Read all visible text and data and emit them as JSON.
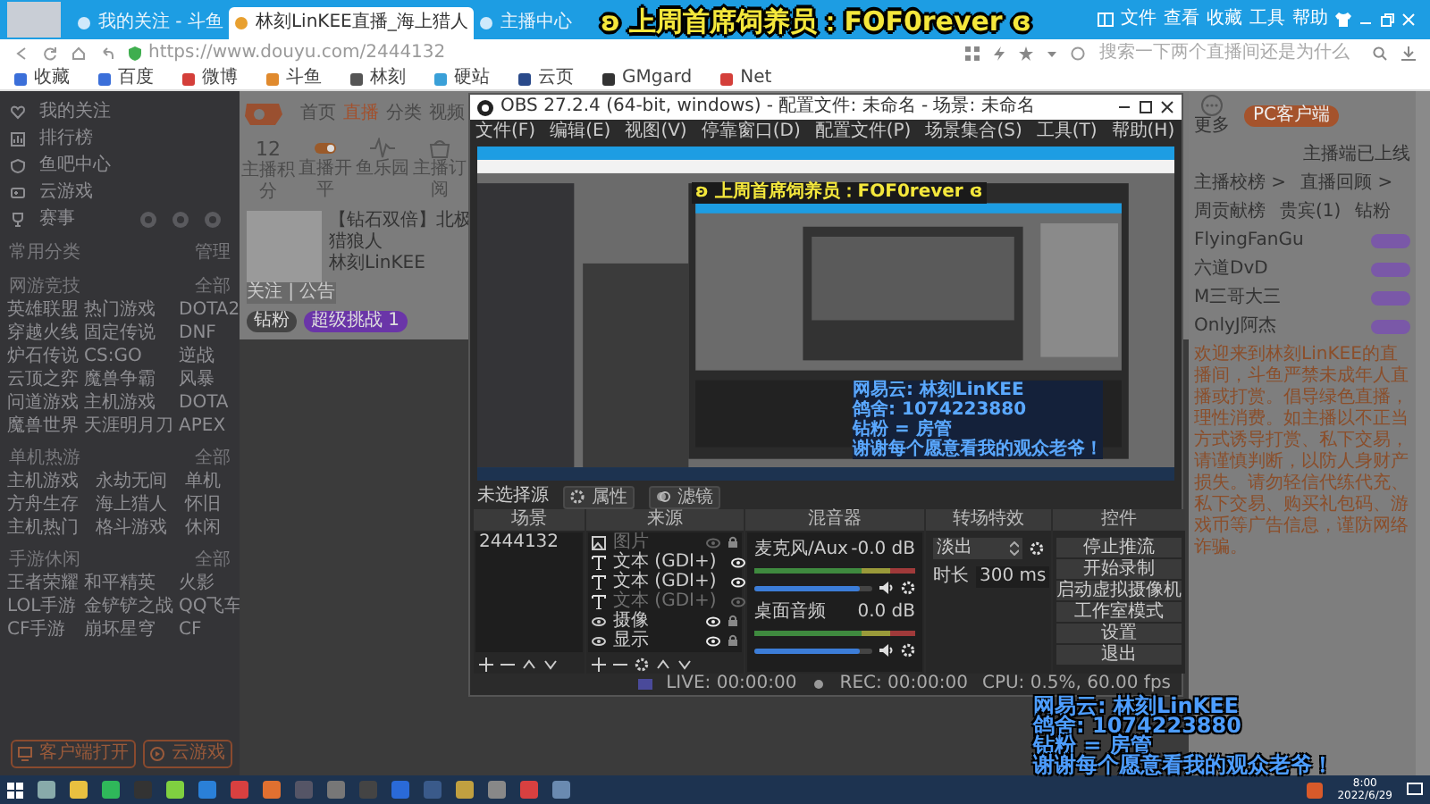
{
  "browser": {
    "tabs": [
      {
        "label": "我的关注 - 斗鱼",
        "selected": false
      },
      {
        "label": "林刻LinKEE直播_海上猎人",
        "selected": true
      },
      {
        "label": "主播中心",
        "selected": false
      }
    ],
    "menu": [
      "文件",
      "查看",
      "收藏",
      "工具",
      "帮助"
    ],
    "url": "https://www.douyu.com/2444132",
    "search": {
      "placeholder": "搜索一下两个直播间还是为什么"
    },
    "bookmarks": [
      "收藏",
      "百度",
      "微博",
      "斗鱼",
      "林刻",
      "硬站",
      "云页",
      "GMgard",
      "Net"
    ]
  },
  "overlay_title": "ʚ 上周首席饲养员：FOF0rever ɞ",
  "site": {
    "nav": [
      {
        "label": "首页",
        "selected": false
      },
      {
        "label": "直播",
        "selected": true
      },
      {
        "label": "分类",
        "selected": false
      },
      {
        "label": "视频",
        "selected": false
      }
    ],
    "sidebar": {
      "items": [
        "我的关注",
        "排行榜",
        "鱼吧中心",
        "云游戏",
        "赛事"
      ],
      "sections": [
        {
          "title": "常用分类",
          "more": "管理"
        },
        {
          "title": "网游竞技",
          "more": "全部",
          "items": [
            "英雄联盟",
            "热门游戏",
            "DOTA2",
            "穿越火线",
            "固定传说",
            "DNF",
            "炉石传说",
            "CS:GO",
            "逆战",
            "云顶之弈",
            "魔兽争霸",
            "风暴",
            "问道游戏",
            "主机游戏",
            "DOTA",
            "魔兽世界",
            "天涯明月刀",
            "APEX"
          ]
        },
        {
          "title": "单机热游",
          "more": "全部",
          "items": [
            "主机游戏",
            "永劫无间",
            "单机",
            "方舟生存",
            "海上猎人",
            "怀旧",
            "主机热门",
            "格斗游戏",
            "休闲"
          ]
        },
        {
          "title": "手游休闲",
          "more": "全部",
          "items": [
            "王者荣耀",
            "和平精英",
            "火影",
            "LOL手游",
            "金铲铲之战",
            "QQ飞车",
            "CF手游",
            "崩坏星穹",
            "CF"
          ]
        }
      ],
      "buttons": [
        "客户端打开",
        "云游戏"
      ]
    },
    "stats": [
      {
        "value": "12",
        "label": "主播积分"
      },
      {
        "label": "直播开平"
      },
      {
        "label": "鱼乐园"
      },
      {
        "label": "主播订阅"
      }
    ],
    "streamer": {
      "avatar_caption": "关注 | 公告",
      "title": "【钻石双倍】北极猎狼人",
      "name": "林刻LinKEE",
      "badges": [
        "钻粉",
        "超级挑战 1"
      ]
    },
    "side_panel": {
      "more": "更多",
      "client_button": "PC客户端",
      "client_note": "主播端已上线",
      "links": [
        "主播校榜 >",
        "直播回顾 >"
      ],
      "tabs": [
        "周贡献榜",
        "贵宾(1)",
        "钻粉"
      ],
      "fans": [
        "FlyingFanGu",
        "六道DvD",
        "M三哥大三",
        "OnlyJ阿杰"
      ],
      "notice": "欢迎来到林刻LinKEE的直播间，斗鱼严禁未成年人直播或打赏。倡导绿色直播，理性消费。如主播以不正当方式诱导打赏、私下交易，请谨慎判断，以防人身财产损失。请勿轻信代练代充、私下交易、购买礼包码、游戏币等广告信息，谨防网络诈骗。"
    }
  },
  "obs": {
    "title": "OBS 27.2.4 (64-bit, windows) - 配置文件: 未命名 - 场景: 未命名",
    "menu": [
      "文件(F)",
      "编辑(E)",
      "视图(V)",
      "停靠窗口(D)",
      "配置文件(P)",
      "场景集合(S)",
      "工具(T)",
      "帮助(H)"
    ],
    "preview_title": "ʚ 上周首席饲养员：FOF0rever ɞ",
    "preview_lines": [
      "网易云: 林刻LinKEE",
      "鸽舍: 1074223880",
      "钻粉 = 房管",
      "谢谢每个愿意看我的观众老爷！"
    ],
    "no_source": "未选择源",
    "source_buttons": [
      "属性",
      "滤镜"
    ],
    "docks": [
      "场景",
      "来源",
      "混音器",
      "转场特效",
      "控件"
    ],
    "scenes": [
      "2444132"
    ],
    "sources": [
      {
        "kind": "image",
        "name": "图片",
        "visible": false
      },
      {
        "kind": "text",
        "name": "文本 (GDI+)",
        "visible": true
      },
      {
        "kind": "text",
        "name": "文本 (GDI+)",
        "visible": true
      },
      {
        "kind": "text",
        "name": "文本 (GDI+)",
        "visible": false
      },
      {
        "kind": "capture",
        "name": "摄像",
        "visible": true
      },
      {
        "kind": "capture",
        "name": "显示",
        "visible": true
      }
    ],
    "mixer": [
      {
        "name": "麦克风/Aux",
        "reading": "-0.0 dB",
        "level": 0.9
      },
      {
        "name": "桌面音频",
        "reading": "0.0 dB",
        "level": 0.9
      }
    ],
    "transition": {
      "value": "淡出",
      "duration_label": "时长",
      "duration": "300 ms"
    },
    "controls": [
      "停止推流",
      "开始录制",
      "启动虚拟摄像机",
      "工作室模式",
      "设置",
      "退出"
    ],
    "status": [
      "LIVE: 00:00:00",
      "REC: 00:00:00",
      "CPU: 0.5%, 60.00 fps"
    ]
  },
  "stream_overlay": [
    "网易云: 林刻LinKEE",
    "鸽舍: 1074223880",
    "钻粉 = 房管",
    "谢谢每个愿意看我的观众老爷！"
  ],
  "taskbar": {
    "time": "8:00",
    "date": "2022/6/29"
  }
}
